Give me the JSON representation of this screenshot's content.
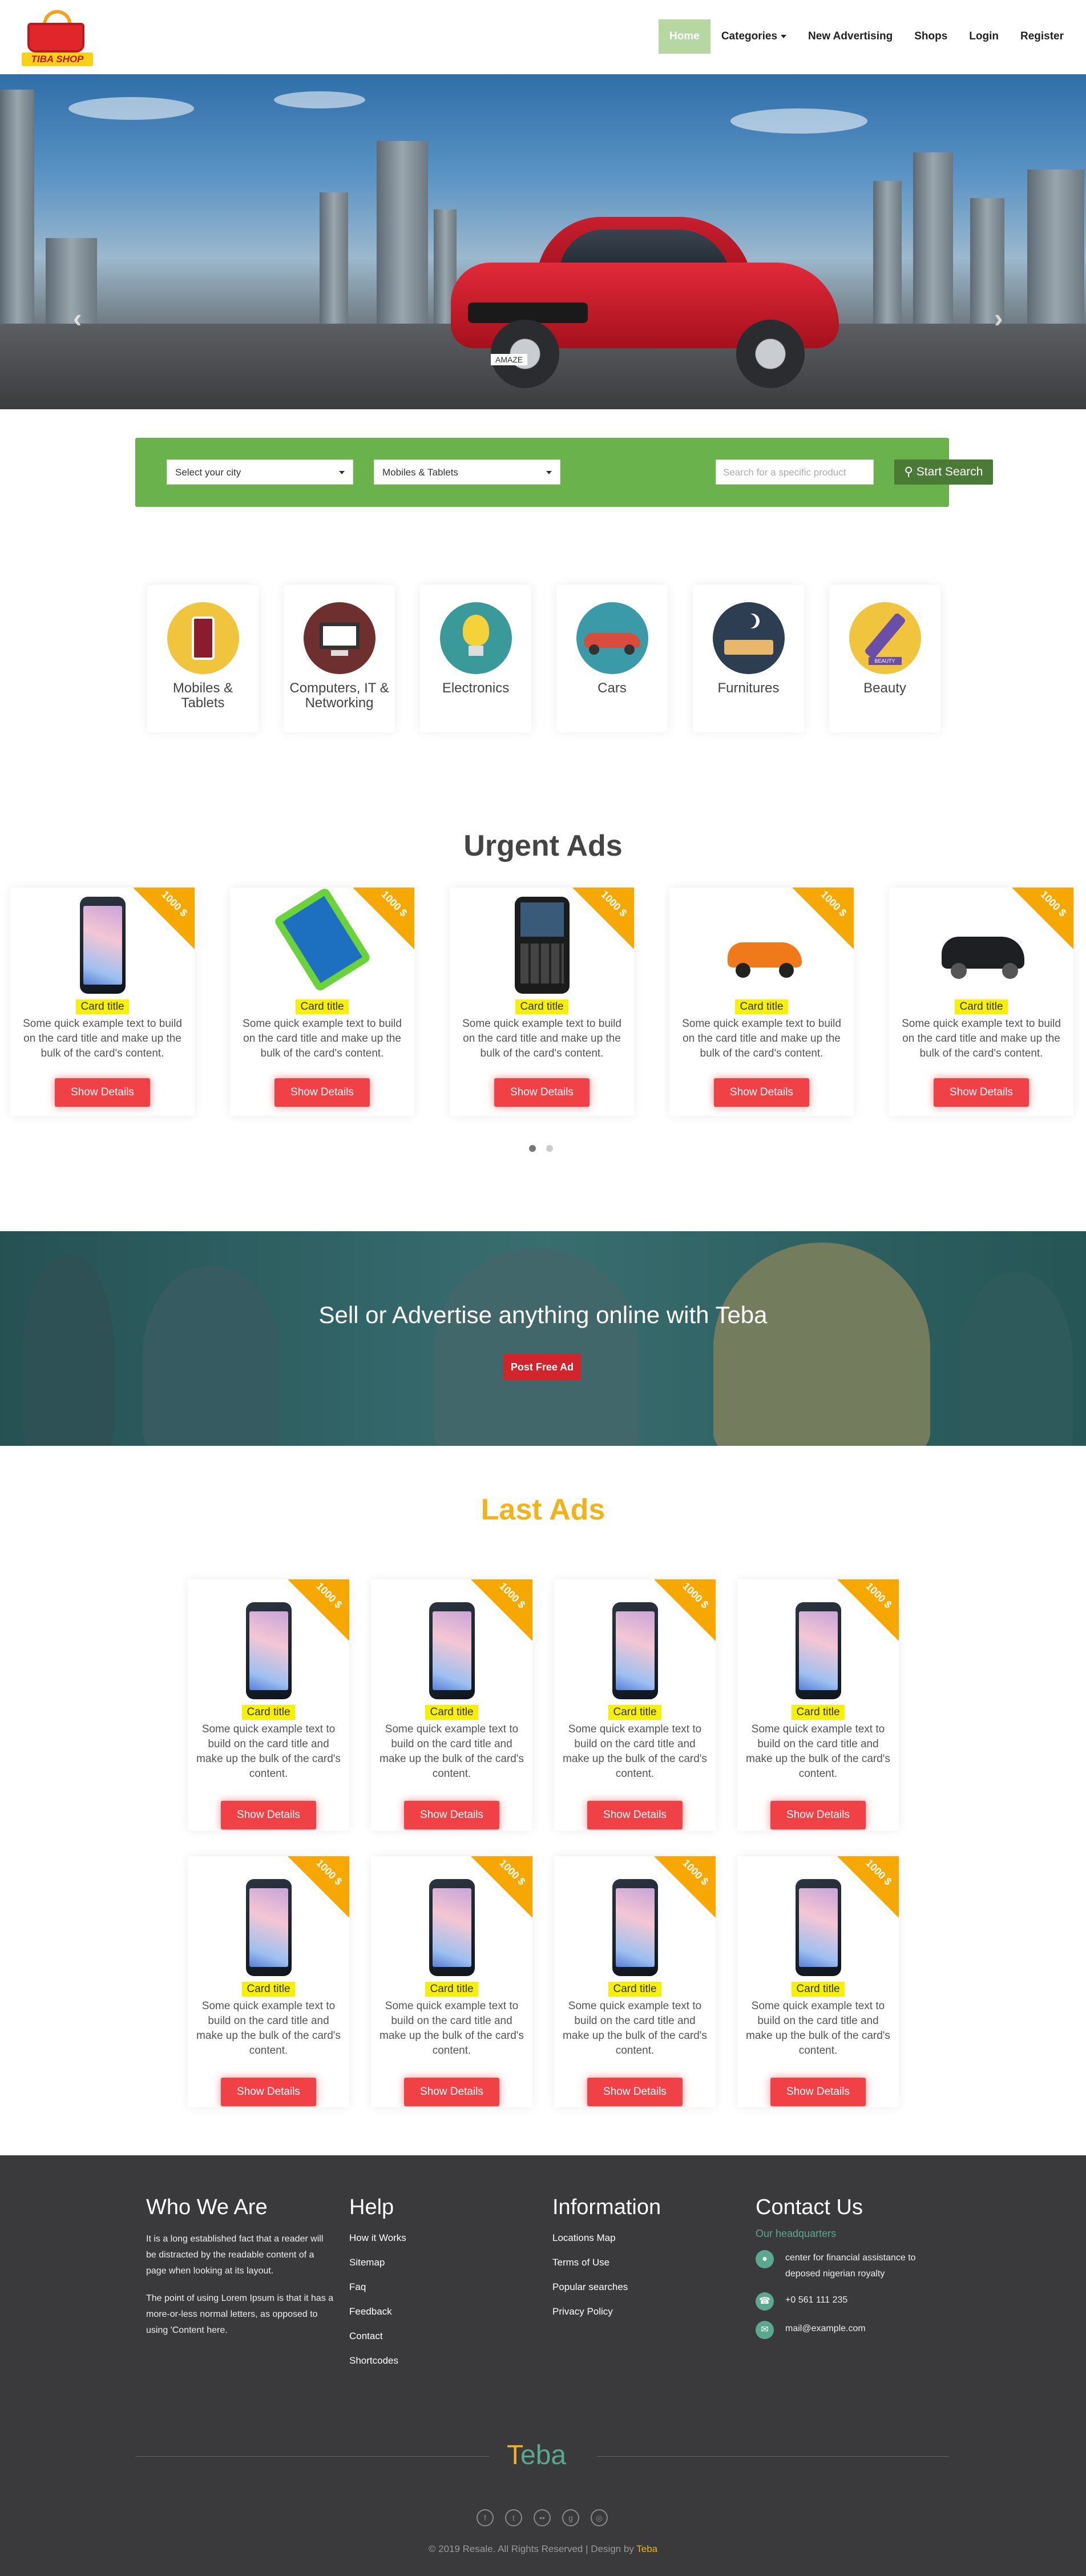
{
  "brand": {
    "logo_text": "TIBA SHOP"
  },
  "nav": {
    "items": [
      {
        "label": "Home",
        "active": true
      },
      {
        "label": "Categories",
        "dropdown": true
      },
      {
        "label": "New Advertising"
      },
      {
        "label": "Shops"
      },
      {
        "label": "Login"
      },
      {
        "label": "Register"
      }
    ]
  },
  "hero": {
    "car_badge": "AMAZE",
    "slides": 3,
    "active_slide": 3,
    "prev_glyph": "‹",
    "next_glyph": "›"
  },
  "search": {
    "city_selected": "Select your city",
    "category_selected": "Mobiles & Tablets",
    "query_placeholder": "Search for a specific product",
    "button_label": "Start Search",
    "bg_color": "#6ab24c"
  },
  "categories": [
    {
      "label": "Mobiles & Tablets",
      "icon": "phone-icon",
      "color": "#f0c43c"
    },
    {
      "label": "Computers, IT & Networking",
      "icon": "monitor-icon",
      "color": "#6e2f2f"
    },
    {
      "label": "Electronics",
      "icon": "lightbulb-icon",
      "color": "#3a9a9a"
    },
    {
      "label": "Cars",
      "icon": "car-icon",
      "color": "#3a9aa8"
    },
    {
      "label": "Furnitures",
      "icon": "bed-icon",
      "color": "#2e3e52"
    },
    {
      "label": "Beauty",
      "icon": "beauty-icon",
      "color": "#f0c43c"
    }
  ],
  "urgent": {
    "title": "Urgent Ads",
    "cards": [
      {
        "price": "1000 $",
        "title": "Card title",
        "text": "Some quick example text to build on the card title and make up the bulk of the card's content.",
        "button": "Show Details",
        "image": "smartphone"
      },
      {
        "price": "1000 $",
        "title": "Card title",
        "text": "Some quick example text to build on the card title and make up the bulk of the card's content.",
        "button": "Show Details",
        "image": "green-phone"
      },
      {
        "price": "1000 $",
        "title": "Card title",
        "text": "Some quick example text to build on the card title and make up the bulk of the card's content.",
        "button": "Show Details",
        "image": "blackberry"
      },
      {
        "price": "1000 $",
        "title": "Card title",
        "text": "Some quick example text to build on the card title and make up the bulk of the card's content.",
        "button": "Show Details",
        "image": "orange-car"
      },
      {
        "price": "1000 $",
        "title": "Card title",
        "text": "Some quick example text to build on the card title and make up the bulk of the card's content.",
        "button": "Show Details",
        "image": "black-suv"
      }
    ]
  },
  "banner": {
    "title": "Sell or Advertise anything online with Teba",
    "button": "Post Free Ad"
  },
  "last": {
    "title": "Last Ads",
    "title_color": "#f2b21a",
    "card": {
      "price": "1000 $",
      "title": "Card title",
      "text": "Some quick example text to build on the card title and make up the bulk of the card's content.",
      "button": "Show Details"
    }
  },
  "footer": {
    "who": {
      "title": "Who We Are",
      "p1": "It is a long established fact that a reader will be distracted by the readable content of a page when looking at its layout.",
      "p2": "The point of using Lorem Ipsum is that it has a more-or-less normal letters, as opposed to using 'Content here."
    },
    "help": {
      "title": "Help",
      "links": [
        "How it Works",
        "Sitemap",
        "Faq",
        "Feedback",
        "Contact",
        "Shortcodes"
      ]
    },
    "info": {
      "title": "Information",
      "links": [
        "Locations Map",
        "Terms of Use",
        "Popular searches",
        "Privacy Policy"
      ]
    },
    "contact": {
      "title": "Contact Us",
      "subtitle": "Our headquarters",
      "address": "center for financial assistance to deposed nigerian royalty",
      "phone": "+0 561 111 235",
      "email": "mail@example.com"
    },
    "logo_first": "T",
    "logo_rest": "eba",
    "copyright_prefix": "© 2019 Resale. All Rights Reserved | Design by",
    "copyright_link": "Teba",
    "social": [
      "facebook-icon",
      "twitter-icon",
      "flickr-icon",
      "googleplus-icon",
      "dribbble-icon"
    ]
  }
}
